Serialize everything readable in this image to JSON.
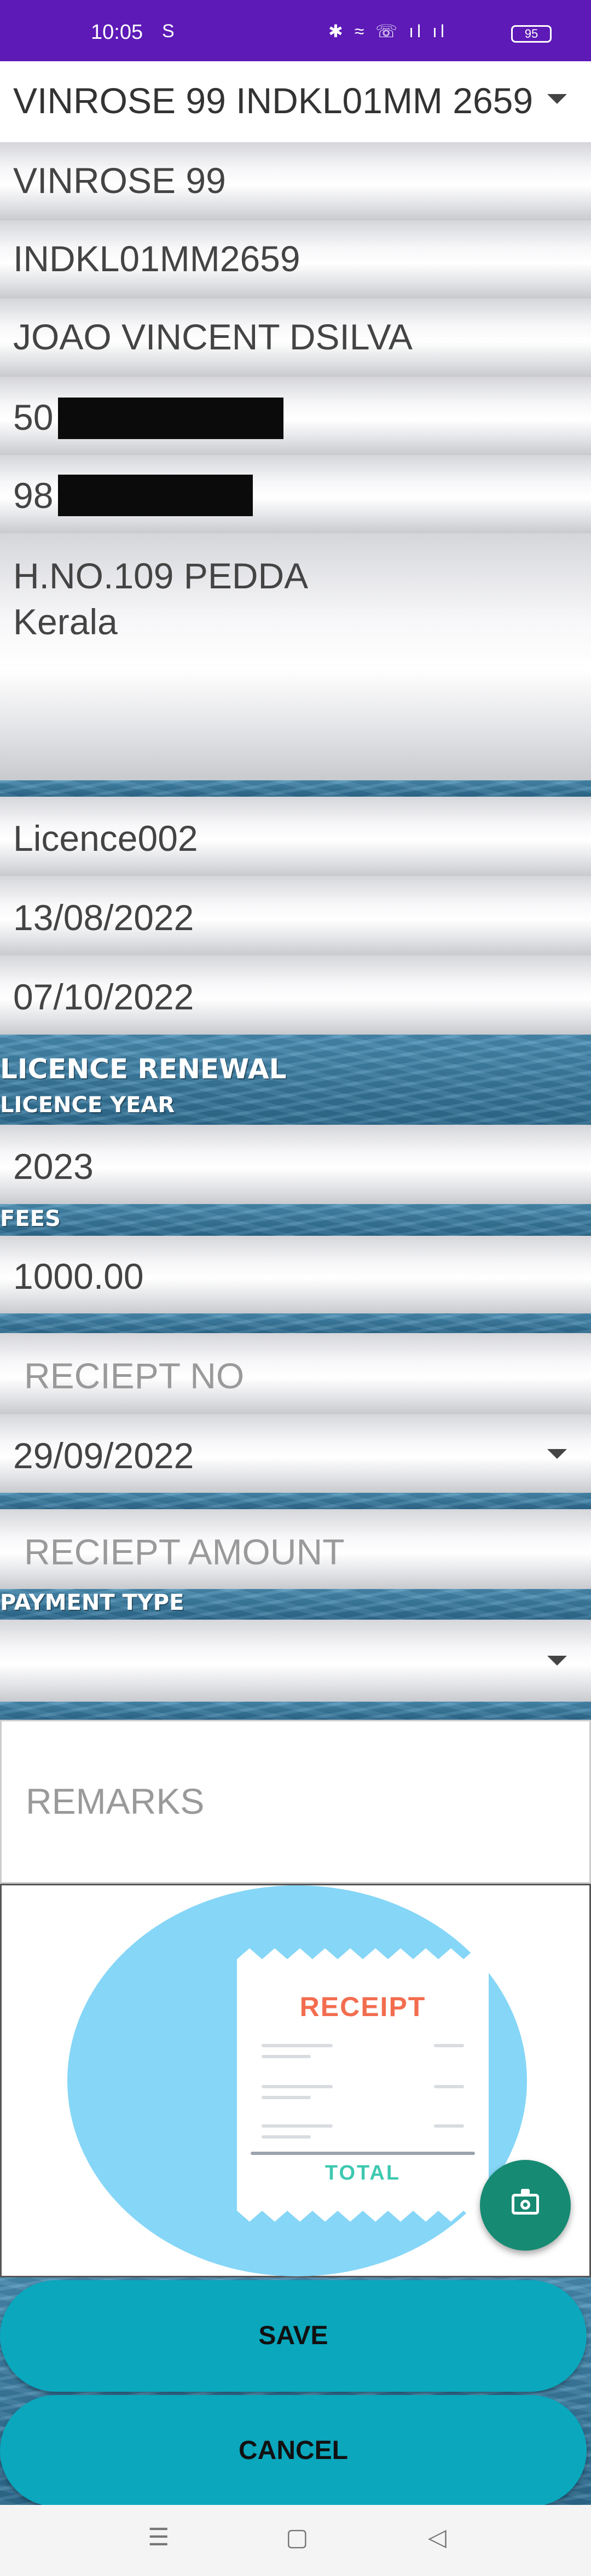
{
  "status_bar": {
    "time": "10:05",
    "extra": "S",
    "icons": "✱ ≈ ☏ ıl ıl",
    "battery": "95"
  },
  "vessel_select": {
    "value": "VINROSE 99 INDKL01MM 2659"
  },
  "vessel_info": {
    "name": "VINROSE 99",
    "registration": "INDKL01MM2659",
    "owner": "JOAO VINCENT DSILVA",
    "id_prefix": "50",
    "phone_prefix": "98",
    "address_line1": "H.NO.109 PEDDA",
    "address_line2": "Kerala"
  },
  "licence": {
    "number": "Licence002",
    "issue_date": "13/08/2022",
    "expiry_date": "07/10/2022"
  },
  "renewal": {
    "section_title": "LICENCE RENEWAL",
    "year_label": "LICENCE YEAR",
    "year_value": "2023",
    "fees_label": "FEES",
    "fees_value": "1000.00",
    "receipt_no_placeholder": "RECIEPT NO",
    "receipt_date": "29/09/2022",
    "receipt_amount_placeholder": "RECIEPT AMOUNT",
    "payment_type_label": "PAYMENT TYPE",
    "payment_type_value": "",
    "remarks_placeholder": "REMARKS"
  },
  "receipt_image": {
    "title": "RECEIPT",
    "total": "TOTAL"
  },
  "buttons": {
    "save": "SAVE",
    "cancel": "CANCEL"
  },
  "colors": {
    "status_bar": "#5d1ab6",
    "button": "#0aa7bd",
    "fab": "#168a72",
    "image_oval": "#86d6f7"
  }
}
